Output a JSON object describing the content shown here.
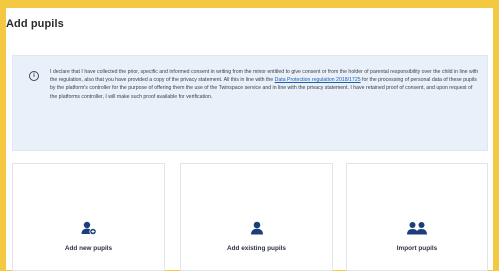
{
  "page": {
    "title": "Add pupils"
  },
  "notice": {
    "icon": "info-circle-icon",
    "text_before": "I declare that I have collected the prior, specific and informed consent in writing from the minor entitled to give consent or from the holder of parental responsibility over the child in line with the regulation, also that you have provided a copy of the privacy statement. All this in line with the ",
    "link_text": "Data Protection regulation 2018/1725",
    "text_after": " for the processing of personal data of these pupils by the platform's controller for the purpose of offering them the use of the Twinspace service and in line with the privacy statement. I have retained proof of consent, and upon request of the platforms controller, I will make such proof available for verification."
  },
  "actions": [
    {
      "label": "Add new pupils",
      "icon": "add-user-icon"
    },
    {
      "label": "Add existing pupils",
      "icon": "user-icon"
    },
    {
      "label": "Import pupils",
      "icon": "users-group-icon"
    }
  ],
  "colors": {
    "frame": "#f5c842",
    "icon": "#1c3f7a",
    "notice_bg": "#e9f0fa",
    "link": "#1b5fb0"
  }
}
